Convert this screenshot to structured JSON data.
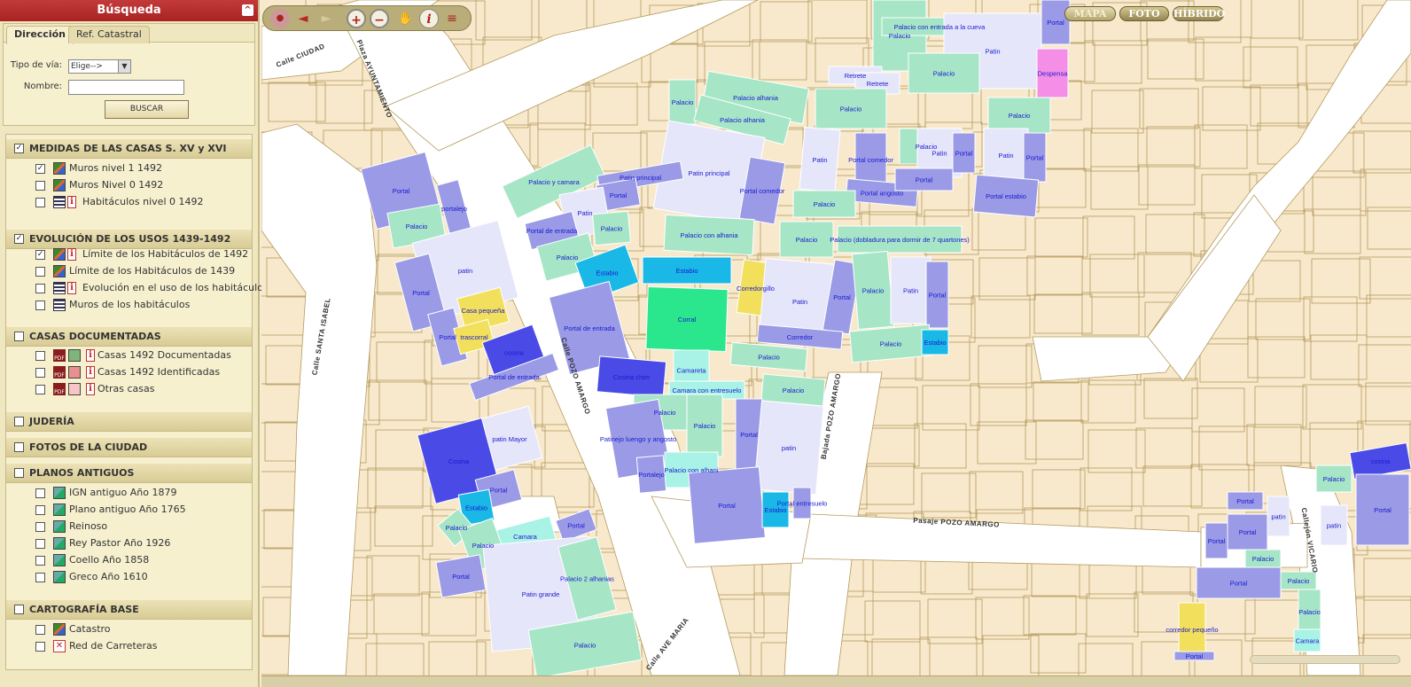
{
  "search": {
    "title": "Búsqueda",
    "collapse_icon": "^",
    "tabs": [
      "Dirección",
      "Ref. Catastral"
    ],
    "via_label": "Tipo de vía:",
    "via_value": "Elige-->",
    "nombre_label": "Nombre:",
    "nombre_value": "",
    "buscar_label": "BUSCAR"
  },
  "layer_groups": [
    {
      "title": "MEDIDAS DE LAS CASAS S. XV y XVI",
      "checked": true,
      "layers": [
        {
          "label": "Muros nivel 1 1492",
          "checked": true,
          "icon": "grid-icon",
          "info": false
        },
        {
          "label": "Muros Nivel 0 1492",
          "checked": false,
          "icon": "grid-icon",
          "info": false
        },
        {
          "label": "Habitáculos nivel 0 1492",
          "checked": false,
          "icon": "list-icon",
          "info": true
        }
      ]
    },
    {
      "title": "EVOLUCIÓN DE LOS USOS 1439-1492",
      "checked": true,
      "layers": [
        {
          "label": "Límite de los Habitáculos de 1492",
          "checked": true,
          "icon": "grid-icon",
          "info": true
        },
        {
          "label": "Límite de los Habitáculos de 1439",
          "checked": false,
          "icon": "grid-icon",
          "info": false
        },
        {
          "label": "Evolución en el uso de los habitáculos",
          "checked": false,
          "icon": "list-icon",
          "info": true
        },
        {
          "label": "Muros de los habitáculos",
          "checked": false,
          "icon": "list-icon",
          "info": false
        }
      ]
    },
    {
      "title": "CASAS DOCUMENTADAS",
      "checked": false,
      "layers": [
        {
          "label": "Casas 1492 Documentadas",
          "checked": false,
          "icon": "pdf-icon",
          "swatch": "#7fb57a",
          "info": true
        },
        {
          "label": "Casas 1492 Identificadas",
          "checked": false,
          "icon": "pdf-icon",
          "swatch": "#e88f8f",
          "info": true
        },
        {
          "label": "Otras casas",
          "checked": false,
          "icon": "pdf-icon",
          "swatch": "#f6c6c6",
          "info": true
        }
      ]
    },
    {
      "title": "JUDERÍA",
      "checked": false,
      "layers": []
    },
    {
      "title": "FOTOS DE LA CIUDAD",
      "checked": false,
      "layers": []
    },
    {
      "title": "PLANOS ANTIGUOS",
      "checked": false,
      "layers": [
        {
          "label": "IGN antiguo Año 1879",
          "checked": false,
          "icon": "plano-icon",
          "info": false
        },
        {
          "label": "Plano antiguo Año 1765",
          "checked": false,
          "icon": "plano-icon",
          "info": false
        },
        {
          "label": "Reinoso",
          "checked": false,
          "icon": "plano-icon",
          "info": false
        },
        {
          "label": "Rey Pastor Año 1926",
          "checked": false,
          "icon": "plano-icon",
          "info": false
        },
        {
          "label": "Coello Año 1858",
          "checked": false,
          "icon": "plano-icon",
          "info": false
        },
        {
          "label": "Greco Año 1610",
          "checked": false,
          "icon": "plano-icon",
          "info": false
        }
      ]
    },
    {
      "title": "CARTOGRAFÍA BASE",
      "checked": false,
      "layers": [
        {
          "label": "Catastro",
          "checked": false,
          "icon": "grid-icon",
          "info": false
        },
        {
          "label": "Red de Carreteras",
          "checked": false,
          "icon": "road-icon",
          "info": false
        }
      ]
    }
  ],
  "toolbar": {
    "tools": [
      {
        "name": "pin-icon",
        "glyph": "●"
      },
      {
        "name": "back-arrow-icon",
        "glyph": "◄"
      },
      {
        "name": "forward-arrow-icon",
        "glyph": "►"
      },
      {
        "name": "zoom-in-icon",
        "glyph": "+"
      },
      {
        "name": "zoom-out-icon",
        "glyph": "−"
      },
      {
        "name": "hand-pan-icon",
        "glyph": "✋"
      },
      {
        "name": "info-icon",
        "glyph": "i"
      },
      {
        "name": "measure-icon",
        "glyph": "≡"
      }
    ]
  },
  "map_modes": [
    "MAPA",
    "FOTO",
    "HÍBRIDO"
  ],
  "colors": {
    "street": "#ffffff",
    "parcel": "#f8e9cc",
    "parcel_line": "#b49a5e",
    "portal": "#9a9ae6",
    "palacio": "#a6e6c6",
    "patin": "#e6e6fa",
    "cosina": "#4a4ae6",
    "estab": "#1ab8e6",
    "corral": "#2ae68c",
    "yellow": "#f2e05c",
    "camara": "#a8f2e6",
    "despensa": "#f58ee6",
    "label": "#1a1ad0"
  },
  "streets": [
    {
      "text": "Calle  CIUDAD",
      "rot": -22
    },
    {
      "text": "Plaza  AYUNTAMIENTO",
      "rot": 68
    },
    {
      "text": "Calle  SANTA ISABEL",
      "rot": -80
    },
    {
      "text": "Calle  POZO AMARGO",
      "rot": 72
    },
    {
      "text": "Bajada  POZO AMARGO",
      "rot": -80
    },
    {
      "text": "Pasaje  POZO AMARGO",
      "rot": 3
    },
    {
      "text": "Calle  AVE MARIA",
      "rot": -52
    },
    {
      "text": "Callejón  VICARIO",
      "rot": 80
    }
  ],
  "rooms": [
    {
      "t": "Portal",
      "c": "portal"
    },
    {
      "t": "Palacio",
      "c": "palacio"
    },
    {
      "t": "Palacio con entrada a la cueva",
      "c": "palacio"
    },
    {
      "t": "Patin",
      "c": "patin"
    },
    {
      "t": "Despensa",
      "c": "despensa"
    },
    {
      "t": "Retrete",
      "c": "patin"
    },
    {
      "t": "Retrete",
      "c": "patin"
    },
    {
      "t": "Palacio",
      "c": "palacio"
    },
    {
      "t": "Palacio alhania",
      "c": "palacio"
    },
    {
      "t": "Palacio alhania",
      "c": "palacio"
    },
    {
      "t": "Palacio",
      "c": "palacio"
    },
    {
      "t": "Palacio",
      "c": "palacio"
    },
    {
      "t": "Palacio",
      "c": "palacio"
    },
    {
      "t": "Patin principal",
      "c": "patin"
    },
    {
      "t": "Portal comedor",
      "c": "portal"
    },
    {
      "t": "Patin",
      "c": "patin"
    },
    {
      "t": "Portal comedor",
      "c": "portal"
    },
    {
      "t": "Palacio",
      "c": "palacio"
    },
    {
      "t": "Patin",
      "c": "patin"
    },
    {
      "t": "Portal",
      "c": "portal"
    },
    {
      "t": "Patin",
      "c": "patin"
    },
    {
      "t": "Portal",
      "c": "portal"
    },
    {
      "t": "Portal angosto",
      "c": "portal"
    },
    {
      "t": "Portal",
      "c": "portal"
    },
    {
      "t": "Portal estabio",
      "c": "portal"
    },
    {
      "t": "Palacio",
      "c": "palacio"
    },
    {
      "t": "Palacio y camara",
      "c": "palacio"
    },
    {
      "t": "Patin principal",
      "c": "portal"
    },
    {
      "t": "Portal",
      "c": "portal"
    },
    {
      "t": "Patin",
      "c": "patin"
    },
    {
      "t": "Palacio",
      "c": "palacio"
    },
    {
      "t": "Portal de entrada",
      "c": "portal"
    },
    {
      "t": "Palacio",
      "c": "palacio"
    },
    {
      "t": "Portal",
      "c": "portal"
    },
    {
      "t": "portalejo",
      "c": "portal"
    },
    {
      "t": "Palacio",
      "c": "palacio"
    },
    {
      "t": "Palacio con alhania",
      "c": "palacio"
    },
    {
      "t": "Palacio",
      "c": "palacio"
    },
    {
      "t": "Palacio (dobladura para dormir de 7 quartones)",
      "c": "palacio"
    },
    {
      "t": "Estabio",
      "c": "estab"
    },
    {
      "t": "Estabio",
      "c": "estab"
    },
    {
      "t": "Corredorgillo",
      "c": "yellow"
    },
    {
      "t": "Corral",
      "c": "corral"
    },
    {
      "t": "Patin",
      "c": "patin"
    },
    {
      "t": "Portal",
      "c": "portal"
    },
    {
      "t": "Palacio",
      "c": "palacio"
    },
    {
      "t": "Patin",
      "c": "patin"
    },
    {
      "t": "Portal",
      "c": "portal"
    },
    {
      "t": "Corredor",
      "c": "portal"
    },
    {
      "t": "Palacio",
      "c": "palacio"
    },
    {
      "t": "Estabio",
      "c": "estab"
    },
    {
      "t": "patin",
      "c": "patin"
    },
    {
      "t": "Portal",
      "c": "portal"
    },
    {
      "t": "Casa pequeña",
      "c": "yellow"
    },
    {
      "t": "Portal",
      "c": "portal"
    },
    {
      "t": "trascorral",
      "c": "yellow"
    },
    {
      "t": "cosina",
      "c": "cosina"
    },
    {
      "t": "Portal de entrada",
      "c": "portal"
    },
    {
      "t": "Portal de entrada",
      "c": "portal"
    },
    {
      "t": "Palacio",
      "c": "palacio"
    },
    {
      "t": "Camareta",
      "c": "camara"
    },
    {
      "t": "Palacio",
      "c": "palacio"
    },
    {
      "t": "Cosina chim",
      "c": "cosina"
    },
    {
      "t": "Camara con entresuelo",
      "c": "camara"
    },
    {
      "t": "Palacio",
      "c": "palacio"
    },
    {
      "t": "Palacio",
      "c": "palacio"
    },
    {
      "t": "Patinejo luengo y angosto",
      "c": "portal"
    },
    {
      "t": "Portal",
      "c": "portal"
    },
    {
      "t": "patin",
      "c": "patin"
    },
    {
      "t": "Palacio con alhani",
      "c": "camara"
    },
    {
      "t": "Portalejo",
      "c": "portal"
    },
    {
      "t": "Portal",
      "c": "portal"
    },
    {
      "t": "Estabio",
      "c": "estab"
    },
    {
      "t": "Portal entresuelo",
      "c": "portal"
    },
    {
      "t": "patin Mayor",
      "c": "patin"
    },
    {
      "t": "Cosina",
      "c": "cosina"
    },
    {
      "t": "Portal",
      "c": "portal"
    },
    {
      "t": "Estabio",
      "c": "estab"
    },
    {
      "t": "Palacio",
      "c": "palacio"
    },
    {
      "t": "Camara",
      "c": "camara"
    },
    {
      "t": "Portal",
      "c": "portal"
    },
    {
      "t": "Palacio",
      "c": "palacio"
    },
    {
      "t": "Portal",
      "c": "portal"
    },
    {
      "t": "Patin grande",
      "c": "patin"
    },
    {
      "t": "Palacio 2 alhanias",
      "c": "palacio"
    },
    {
      "t": "Palacio",
      "c": "palacio"
    },
    {
      "t": "Portal",
      "c": "portal"
    },
    {
      "t": "Portal",
      "c": "portal"
    },
    {
      "t": "patin",
      "c": "patin"
    },
    {
      "t": "Portal",
      "c": "portal"
    },
    {
      "t": "Portal",
      "c": "portal"
    },
    {
      "t": "Palacio",
      "c": "palacio"
    },
    {
      "t": "Palacio",
      "c": "palacio"
    },
    {
      "t": "Palacio",
      "c": "palacio"
    },
    {
      "t": "corredor pequeño",
      "c": "yellow"
    },
    {
      "t": "Portal",
      "c": "portal"
    },
    {
      "t": "Camara",
      "c": "camara"
    },
    {
      "t": "Palacio",
      "c": "palacio"
    },
    {
      "t": "cosina",
      "c": "cosina"
    },
    {
      "t": "patin",
      "c": "patin"
    },
    {
      "t": "Portal",
      "c": "portal"
    }
  ]
}
